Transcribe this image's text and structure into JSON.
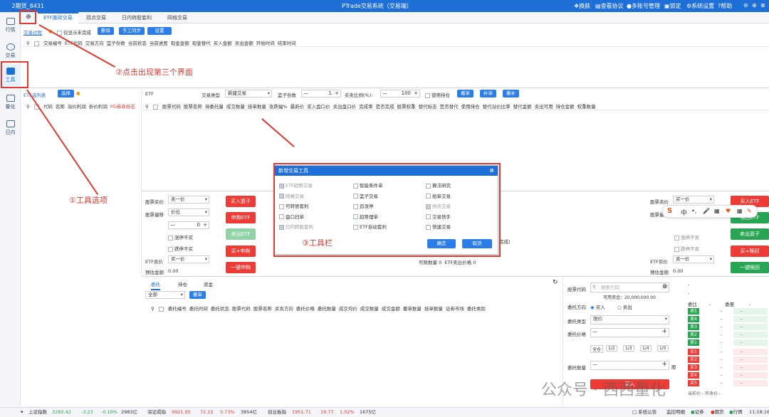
{
  "titlebar": {
    "account": "2期货_8431",
    "title": "PTrade交易系统（交易端）",
    "items": [
      "换肤",
      "查看协议",
      "多账号管理",
      "锁定",
      "系统设置",
      "帮助"
    ]
  },
  "sidebar": [
    {
      "label": "行情"
    },
    {
      "label": "交易"
    },
    {
      "label": "工具"
    },
    {
      "label": "量化"
    },
    {
      "label": "日内"
    }
  ],
  "tabs": [
    "ETF搬砖交易",
    "拐点交易",
    "日内转股套利",
    "网格交易"
  ],
  "toolbar1": {
    "link": "交易过程",
    "only_pending": "仅显示未完成",
    "delete": "删除",
    "manual_sync": "手工同步",
    "settings": "设置"
  },
  "table1_headers": [
    "交易编号",
    "ETF代码",
    "交易方向",
    "篮子份数",
    "当前状态",
    "当前进度",
    "现金金额",
    "现金替代",
    "买入金额",
    "卖出金额",
    "开始时间",
    "结束时间"
  ],
  "etf_panel": {
    "title": "ETF选列表",
    "select": "选择",
    "headers": [
      "代码",
      "名称",
      "溢价利润",
      "折价利润",
      "PD券商标志"
    ]
  },
  "order_bar": {
    "etf_label": "ETF",
    "type_label": "交易类型",
    "type_value": "新建交易",
    "basket_label": "篮子份数",
    "basket_value": "1",
    "buy_ratio_label": "买卖比例(%):",
    "buy_ratio_value": "100",
    "use_hold": "使用持仓",
    "btn_cancel": "撤单",
    "btn_add": "补单",
    "btn_recancel": "撤补"
  },
  "stock_headers": [
    "股票代码",
    "股票名称",
    "待委托量",
    "成交数量",
    "挂单数量",
    "涨跌幅%",
    "最新价",
    "买入盘口价",
    "卖出盘口价",
    "完成率",
    "是否完成",
    "股票权重",
    "替代标志",
    "是否替代",
    "使用持仓",
    "替代溢价比率",
    "替代金额",
    "卖出可用",
    "持仓金额",
    "权重数量"
  ],
  "left_form": {
    "buy_price_label": "股票买价",
    "buy_price": "卖一价",
    "deviation_label": "股票偏移",
    "deviation": "价位",
    "step": "0",
    "limit_up": "涨停不买",
    "limit_halt": "跌停不买",
    "etf_sell_label": "ETF卖价",
    "etf_sell": "买一价",
    "est_amount_label": "预估金额",
    "est_amount": "0.00"
  },
  "left_buttons": [
    "买入篮子",
    "申购ETF",
    "卖出ETF",
    "买+申购",
    "一键申购"
  ],
  "right_form": {
    "sell_price_label": "股票卖价",
    "sell_price": "买一价",
    "deviation_label": "股票偏移",
    "etf_buy_label": "ETF买价",
    "etf_buy": "卖一价",
    "est_amount_label": "预估金额",
    "est_amount": "0.00",
    "limit_up": "涨停不卖",
    "limit_halt": "跌停不卖"
  },
  "right_buttons": [
    "买入ETF",
    "赎回ETF",
    "卖出篮子",
    "买+赎回",
    "一键赎回"
  ],
  "mid_info": {
    "done": "完成)",
    "sellable": "可赎数量",
    "sellable_val": "0",
    "etf_price": "ETF卖出价格",
    "etf_price_val": "0"
  },
  "ime_bar": [
    "S",
    "中",
    "•,",
    "🎤",
    "▦",
    "♥",
    "▦",
    "✎"
  ],
  "dialog": {
    "title": "新增交易工具",
    "options": [
      [
        "ETF趋势交易",
        "智能条件单",
        "算法研究"
      ],
      [
        "网格交易",
        "篮子交易",
        "抢单交易"
      ],
      [
        "可转债套利",
        "追涨停",
        "拐点交易"
      ],
      [
        "盘口扫单",
        "趋势埋单",
        "交易快手"
      ],
      [
        "日内转股套利",
        "ETF自动套利",
        "快速交易"
      ]
    ],
    "disabled": [
      [
        true,
        false,
        false
      ],
      [
        true,
        false,
        false
      ],
      [
        false,
        false,
        true
      ],
      [
        false,
        false,
        false
      ],
      [
        true,
        false,
        false
      ]
    ],
    "checked": [
      [
        true,
        false,
        false
      ],
      [
        true,
        false,
        false
      ],
      [
        false,
        false,
        true
      ],
      [
        false,
        false,
        false
      ],
      [
        true,
        false,
        false
      ]
    ],
    "ok": "确定",
    "cancel": "取消"
  },
  "annotations": {
    "a1": "①工具选项",
    "a2": "②点击出现第三个界面",
    "a3": "③工具栏"
  },
  "bottom_tabs": [
    "委托",
    "持仓",
    "资金"
  ],
  "bottom_filter": {
    "all": "全部",
    "cancel": "撤单"
  },
  "bottom_headers": [
    "委托编号",
    "委托时间",
    "委托状态",
    "股票代码",
    "股票名称",
    "买卖方向",
    "委托价格",
    "委托数量",
    "成交均价",
    "成交数量",
    "成交金额",
    "撤单数量",
    "挂单数量",
    "证券市场",
    "委托类别"
  ],
  "trade_form": {
    "code_label": "股票代码",
    "code_placeholder": "搜索代码",
    "avail": "可用资金：20,000,000.00",
    "dir_label": "委托方向",
    "buy": "买入",
    "sell": "卖出",
    "type_label": "委托类型",
    "type": "限价",
    "price_label": "委托价格",
    "ratios": [
      "全仓",
      "1/2",
      "1/3",
      "1/4",
      "1/5"
    ],
    "qty_label": "委托数量",
    "unit": "股",
    "submit": "买入"
  },
  "quote": {
    "header": [
      "-",
      "-"
    ],
    "cols": [
      "委比",
      "-",
      "委差",
      "-"
    ],
    "sell": [
      "卖5",
      "卖4",
      "卖3",
      "卖2",
      "卖1"
    ],
    "buy": [
      "买1",
      "买2",
      "买3",
      "买4",
      "买5"
    ],
    "dash": "-",
    "foot": "当前价:- 昨收价:-"
  },
  "watermark": "公众号 · 西西量化",
  "statusbar": {
    "idx1": "上证指数",
    "v1": "3283.42",
    "c1": "-3.23",
    "p1": "-0.10%",
    "a1": "2983亿",
    "idx2": "深证成指",
    "v2": "9921.95",
    "c2": "72.15",
    "p2": "0.73%",
    "a2": "3854亿",
    "idx3": "创业板指",
    "v3": "1951.71",
    "c3": "19.77",
    "p3": "1.02%",
    "a3": "1675亿",
    "notice": "系统公告",
    "monitor": "监控明细",
    "s1": "证券",
    "s2": "期货",
    "s3": "行情",
    "time": "11:18:16"
  }
}
